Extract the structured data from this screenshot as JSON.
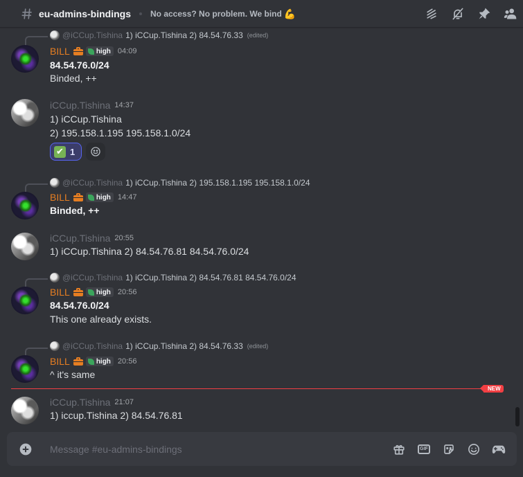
{
  "header": {
    "channel_name": "eu-admins-bindings",
    "topic": "No access? No problem. We bind",
    "topic_emoji": "💪",
    "icons": [
      "threads-icon",
      "mute-icon",
      "pin-icon",
      "members-icon"
    ]
  },
  "messages": [
    {
      "reply": {
        "name": "@iCCup.Tishina",
        "text": "1) iCCup.Tishina  2) 84.54.76.33",
        "edited": "(edited)"
      },
      "author": "BILL",
      "role_tag": "high",
      "time": "04:09",
      "lines": [
        "84.54.76.0/24",
        "Binded,  ++"
      ]
    },
    {
      "author": "iCCup.Tishina",
      "time": "14:37",
      "lines": [
        "1) iCCup.Tishina",
        "2) 195.158.1.195  195.158.1.0/24"
      ],
      "reactions": [
        {
          "emoji": "✔",
          "count": "1"
        }
      ]
    },
    {
      "reply": {
        "name": "@iCCup.Tishina",
        "text": "1) iCCup.Tishina  2) 195.158.1.195  195.158.1.0/24"
      },
      "author": "BILL",
      "role_tag": "high",
      "time": "14:47",
      "lines": [
        "Binded,  ++"
      ]
    },
    {
      "author": "iCCup.Tishina",
      "time": "20:55",
      "lines": [
        "1) iCCup.Tishina 2) 84.54.76.81 84.54.76.0/24"
      ]
    },
    {
      "reply": {
        "name": "@iCCup.Tishina",
        "text": "1) iCCup.Tishina 2) 84.54.76.81 84.54.76.0/24"
      },
      "author": "BILL",
      "role_tag": "high",
      "time": "20:56",
      "lines": [
        "84.54.76.0/24",
        "This one already exists."
      ]
    },
    {
      "reply": {
        "name": "@iCCup.Tishina",
        "text": "1) iCCup.Tishina  2) 84.54.76.33",
        "edited": "(edited)"
      },
      "author": "BILL",
      "role_tag": "high",
      "time": "20:56",
      "lines": [
        "^ it's same"
      ]
    },
    {
      "author": "iCCup.Tishina",
      "time": "21:07",
      "lines": [
        "1) iccup.Tishina 2) 84.54.76.81"
      ]
    }
  ],
  "divider": {
    "label": "NEW"
  },
  "composer": {
    "placeholder": "Message #eu-admins-bindings",
    "icons": [
      "gift-icon",
      "gif-icon",
      "sticker-icon",
      "emoji-icon",
      "activities-icon"
    ]
  },
  "colors": {
    "background": "#313338",
    "bill_name": "#e67e22",
    "tishina_name": "#6d7078",
    "new_divider": "#f23f43",
    "reaction_accent": "#5865f2"
  }
}
